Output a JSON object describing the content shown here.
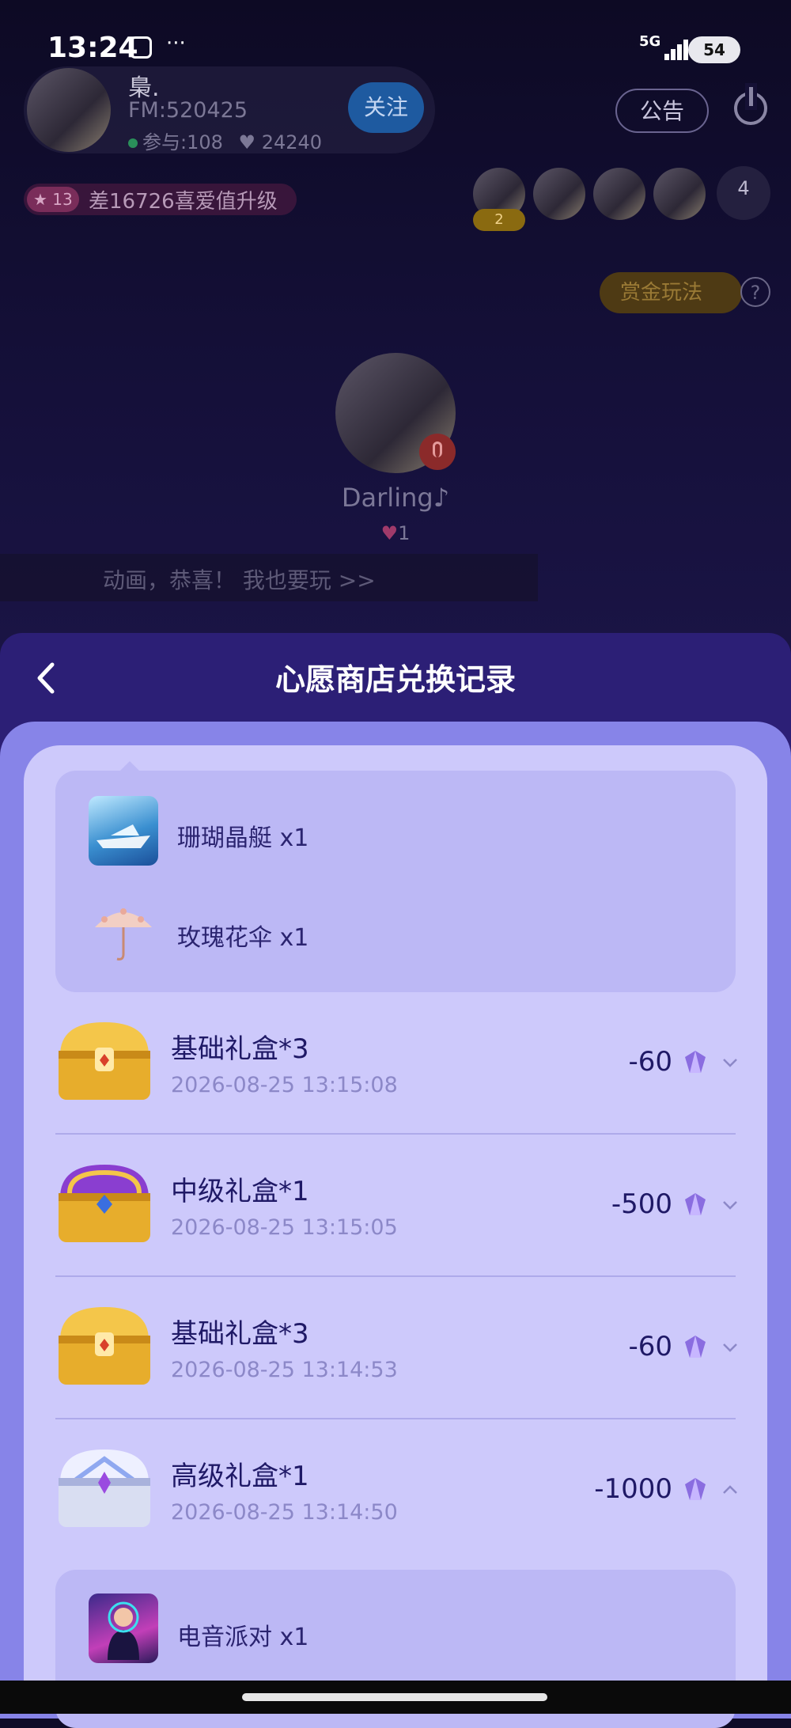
{
  "status_bar": {
    "time": "13:24",
    "network": "5G",
    "battery": "54",
    "more": "···"
  },
  "host": {
    "name": "梟.",
    "fm": "FM:520425",
    "participants": "参与:108",
    "likes": "24240",
    "follow_label": "关注"
  },
  "header_actions": {
    "notice_label": "公告"
  },
  "level": {
    "badge": "13",
    "text": "差16726喜爱值升级"
  },
  "viewers": {
    "badge": "2",
    "count": "4"
  },
  "bounty": {
    "label": "赏金玩法",
    "help": "?"
  },
  "seat": {
    "name": "Darling♪",
    "hearts": "1"
  },
  "chat": {
    "text": "动画，恭喜！ 我也要玩 >>"
  },
  "sheet": {
    "title": "心愿商店兑换记录",
    "top_expanded_items": [
      {
        "label": "珊瑚晶艇 x1",
        "icon": "yacht-icon"
      },
      {
        "label": "玫瑰花伞 x1",
        "icon": "umbrella-icon"
      }
    ],
    "records": [
      {
        "name": "基础礼盒*3",
        "time": "2026-08-25 13:15:08",
        "amount": "-60",
        "icon": "gold-chest-icon",
        "expanded": false
      },
      {
        "name": "中级礼盒*1",
        "time": "2026-08-25 13:15:05",
        "amount": "-500",
        "icon": "purple-gold-chest-icon",
        "expanded": false
      },
      {
        "name": "基础礼盒*3",
        "time": "2026-08-25 13:14:53",
        "amount": "-60",
        "icon": "gold-chest-icon",
        "expanded": false
      },
      {
        "name": "高级礼盒*1",
        "time": "2026-08-25 13:14:50",
        "amount": "-1000",
        "icon": "silver-chest-icon",
        "expanded": true
      }
    ],
    "bottom_expanded_items": [
      {
        "label": "电音派对 x1",
        "icon": "dj-party-icon"
      }
    ]
  },
  "colors": {
    "sheet_header": "#2c1f76",
    "panel_outer": "#8784e8",
    "panel": "#cdc9fb",
    "sub_box": "#bcb8f5",
    "text_primary": "#1f1966",
    "text_secondary": "#8c88c8"
  }
}
